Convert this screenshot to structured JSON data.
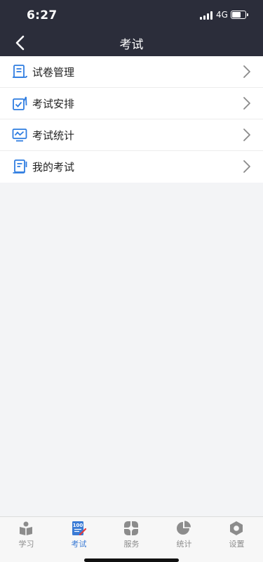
{
  "status_bar": {
    "time": "6:27",
    "network": "4G",
    "battery_level": 0.7
  },
  "nav": {
    "title": "考试",
    "back_icon": "chevron-left-icon"
  },
  "menu": {
    "items": [
      {
        "label": "试卷管理",
        "icon": "paper-list-icon"
      },
      {
        "label": "考试安排",
        "icon": "schedule-check-icon"
      },
      {
        "label": "考试统计",
        "icon": "monitor-chart-icon"
      },
      {
        "label": "我的考试",
        "icon": "my-exam-icon"
      }
    ]
  },
  "tabbar": {
    "tabs": [
      {
        "label": "学习",
        "icon": "study-reader-icon",
        "active": false
      },
      {
        "label": "考试",
        "icon": "exam-100-icon",
        "badge": "100",
        "active": true
      },
      {
        "label": "服务",
        "icon": "service-grid-icon",
        "active": false
      },
      {
        "label": "统计",
        "icon": "pie-chart-icon",
        "active": false
      },
      {
        "label": "设置",
        "icon": "settings-hex-icon",
        "active": false
      }
    ]
  },
  "colors": {
    "header_bg": "#2b2d3a",
    "accent": "#3a7bd5",
    "inactive": "#8c8c8c",
    "icon_blue": "#2f7de1"
  }
}
